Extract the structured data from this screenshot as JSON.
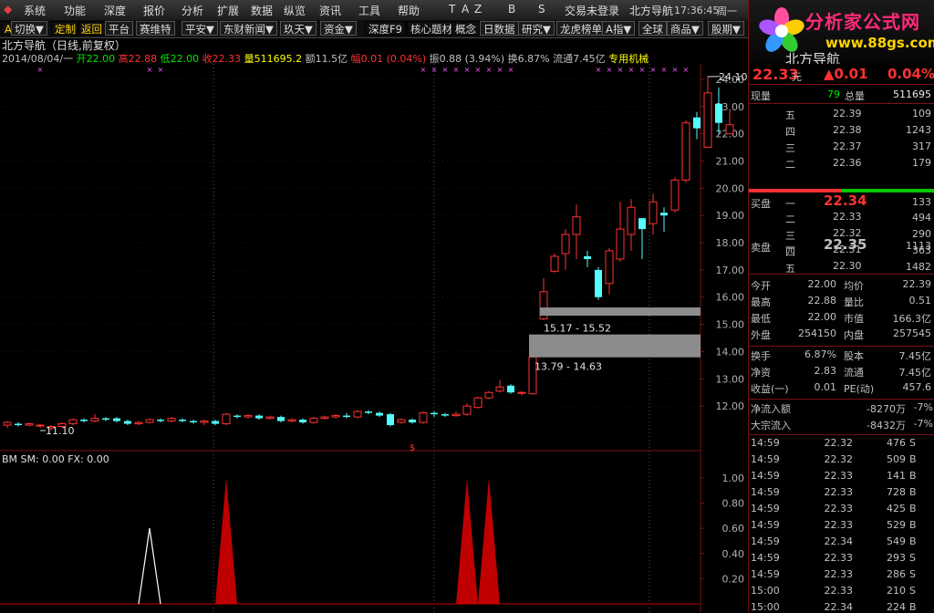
{
  "menu": {
    "items": [
      "系统",
      "功能",
      "深度",
      "报价",
      "分析",
      "扩展",
      "数据",
      "纵览",
      "资讯",
      "工具",
      "帮助"
    ],
    "shortcuts": [
      "T",
      "A",
      "Z",
      "B",
      "S"
    ],
    "login": "交易未登录",
    "app_name": "北方导航",
    "time": "17:36:45",
    "weekday": "周一"
  },
  "toolbar": {
    "mark": "A",
    "switch": "切换▼",
    "custom": "定制",
    "back": "返回",
    "platform": "平台",
    "saiweite": "赛维特",
    "pingan": "平安▼",
    "dongcai": "东财新闻▼",
    "jiutian": "玖天▼",
    "zijin": "资金▼",
    "depth": "深度F9",
    "core": "核心题材",
    "concept": "概念",
    "daily": "日数据",
    "research": "研究▼",
    "dragon": "龙虎榜单",
    "aindex": "A指▼",
    "global": "全球",
    "goods": "商品▼",
    "futures": "股期▼"
  },
  "stock": {
    "title": "北方导航（日线,前复权）",
    "date": "2014/08/04/一",
    "open_label": "开",
    "open": "22.00",
    "high_label": "高",
    "high": "22.88",
    "low_label": "低",
    "low": "22.00",
    "close_label": "收",
    "close": "22.33",
    "vol_label": "量",
    "vol": "511695.2",
    "amt_label": "额",
    "amt": "11.5亿",
    "chg_label": "幅",
    "chg": "0.01 (0.04%)",
    "amp_label": "振",
    "amp": "0.88 (3.94%)",
    "turn_label": "换",
    "turn": "6.87%",
    "float_label": "流通",
    "float": "7.45亿",
    "sector": "专用机械"
  },
  "chart_data": [
    {
      "type": "candlestick",
      "y_ticks": [
        "24.00",
        "23.00",
        "22.00",
        "21.00",
        "20.00",
        "19.00",
        "18.00",
        "17.00",
        "16.00",
        "15.00",
        "14.00",
        "13.00",
        "12.00"
      ],
      "ylim": [
        11.0,
        24.5
      ],
      "annotations": {
        "max_label": "24.10",
        "min_label": "11.10",
        "zone1": "15.17 - 15.52",
        "zone2": "13.79 - 14.63",
        "event_mark": "$"
      },
      "candles": [
        [
          11.3,
          11.4,
          11.2,
          11.45
        ],
        [
          11.35,
          11.3,
          11.25,
          11.4
        ],
        [
          11.3,
          11.35,
          11.25,
          11.4
        ],
        [
          11.3,
          11.3,
          11.2,
          11.35
        ],
        [
          11.2,
          11.25,
          11.1,
          11.3
        ],
        [
          11.25,
          11.35,
          11.2,
          11.4
        ],
        [
          11.35,
          11.5,
          11.3,
          11.55
        ],
        [
          11.5,
          11.45,
          11.4,
          11.55
        ],
        [
          11.45,
          11.55,
          11.4,
          11.7
        ],
        [
          11.55,
          11.5,
          11.45,
          11.6
        ],
        [
          11.55,
          11.45,
          11.4,
          11.6
        ],
        [
          11.45,
          11.35,
          11.3,
          11.5
        ],
        [
          11.35,
          11.4,
          11.3,
          11.45
        ],
        [
          11.4,
          11.5,
          11.35,
          11.55
        ],
        [
          11.5,
          11.45,
          11.4,
          11.55
        ],
        [
          11.45,
          11.55,
          11.4,
          11.6
        ],
        [
          11.5,
          11.45,
          11.4,
          11.55
        ],
        [
          11.45,
          11.4,
          11.35,
          11.5
        ],
        [
          11.4,
          11.45,
          11.3,
          11.5
        ],
        [
          11.45,
          11.35,
          11.3,
          11.5
        ],
        [
          11.35,
          11.7,
          11.3,
          11.75
        ],
        [
          11.65,
          11.6,
          11.55,
          11.7
        ],
        [
          11.6,
          11.65,
          11.55,
          11.7
        ],
        [
          11.65,
          11.55,
          11.5,
          11.7
        ],
        [
          11.55,
          11.6,
          11.5,
          11.65
        ],
        [
          11.6,
          11.45,
          11.4,
          11.65
        ],
        [
          11.45,
          11.5,
          11.4,
          11.55
        ],
        [
          11.5,
          11.4,
          11.35,
          11.55
        ],
        [
          11.4,
          11.55,
          11.35,
          11.6
        ],
        [
          11.55,
          11.6,
          11.5,
          11.65
        ],
        [
          11.6,
          11.65,
          11.55,
          11.7
        ],
        [
          11.65,
          11.6,
          11.55,
          11.75
        ],
        [
          11.6,
          11.8,
          11.55,
          11.85
        ],
        [
          11.8,
          11.75,
          11.7,
          11.85
        ],
        [
          11.75,
          11.65,
          11.6,
          11.8
        ],
        [
          11.7,
          11.3,
          11.25,
          11.75
        ],
        [
          11.4,
          11.5,
          11.35,
          11.55
        ],
        [
          11.5,
          11.4,
          11.35,
          11.55
        ],
        [
          11.4,
          11.75,
          11.35,
          11.8
        ],
        [
          11.75,
          11.7,
          11.6,
          11.8
        ],
        [
          11.7,
          11.65,
          11.6,
          11.75
        ],
        [
          11.65,
          11.7,
          11.6,
          11.8
        ],
        [
          11.7,
          12.0,
          11.65,
          12.1
        ],
        [
          11.95,
          12.3,
          11.9,
          12.35
        ],
        [
          12.3,
          12.5,
          12.25,
          12.55
        ],
        [
          12.55,
          12.7,
          12.5,
          12.95
        ],
        [
          12.75,
          12.5,
          12.45,
          12.8
        ],
        [
          12.5,
          12.5,
          12.4,
          12.55
        ],
        [
          12.45,
          13.8,
          12.45,
          13.8
        ],
        [
          15.2,
          16.2,
          15.15,
          16.7
        ],
        [
          16.95,
          17.5,
          16.9,
          17.6
        ],
        [
          17.6,
          18.3,
          17.0,
          18.5
        ],
        [
          18.3,
          18.95,
          17.4,
          19.4
        ],
        [
          17.5,
          17.4,
          17.1,
          17.7
        ],
        [
          17.0,
          16.0,
          15.9,
          17.1
        ],
        [
          16.5,
          17.7,
          16.1,
          17.8
        ],
        [
          17.4,
          18.5,
          17.3,
          19.5
        ],
        [
          18.3,
          19.3,
          17.7,
          19.6
        ],
        [
          18.9,
          18.5,
          17.4,
          18.9
        ],
        [
          18.7,
          19.5,
          18.3,
          19.8
        ],
        [
          19.1,
          19.0,
          18.4,
          19.3
        ],
        [
          19.2,
          20.3,
          19.1,
          20.4
        ],
        [
          20.3,
          22.4,
          20.2,
          22.5
        ],
        [
          22.6,
          22.2,
          21.8,
          22.8
        ],
        [
          21.5,
          23.5,
          21.5,
          24.1
        ],
        [
          23.1,
          22.4,
          22.0,
          23.7
        ],
        [
          22.0,
          22.33,
          22.0,
          22.88
        ]
      ]
    },
    {
      "type": "area",
      "title": "BM SM: 0.00  FX: 0.00",
      "y_ticks": [
        "1.00",
        "0.80",
        "0.60",
        "0.40",
        "0.20"
      ],
      "ylim": [
        0,
        1.05
      ],
      "red_spikes": [
        {
          "index": 20,
          "value": 1.0
        },
        {
          "index": 42,
          "value": 1.0
        },
        {
          "index": 44,
          "value": 1.0
        }
      ],
      "white_spikes": [
        {
          "index": 13,
          "value": 0.6
        }
      ]
    }
  ],
  "quote": {
    "logo_text": "分析家公式网",
    "logo_url": "www.88gs.com",
    "name": "北方导航",
    "price": "22.33",
    "price_unit": "元",
    "change": "▲0.01",
    "pct": "0.04%",
    "now_vol_label": "现量",
    "now_vol": "79",
    "total_vol_label": "总量",
    "total_vol": "511695",
    "sell_title": "卖盘",
    "buy_title": "买盘",
    "asks": [
      {
        "label": "五",
        "price": "22.39",
        "vol": "109"
      },
      {
        "label": "四",
        "price": "22.38",
        "vol": "1243"
      },
      {
        "label": "三",
        "price": "22.37",
        "vol": "317"
      },
      {
        "label": "二",
        "price": "22.36",
        "vol": "179"
      },
      {
        "label": "一",
        "price": "22.35",
        "vol": "1113"
      }
    ],
    "bids": [
      {
        "label": "一",
        "price": "22.34",
        "vol": "133"
      },
      {
        "label": "二",
        "price": "22.33",
        "vol": "494"
      },
      {
        "label": "三",
        "price": "22.32",
        "vol": "290"
      },
      {
        "label": "四",
        "price": "22.31",
        "vol": "363"
      },
      {
        "label": "五",
        "price": "22.30",
        "vol": "1482"
      }
    ],
    "stats": [
      {
        "l1": "今开",
        "v1": "22.00",
        "l2": "均价",
        "v2": "22.39"
      },
      {
        "l1": "最高",
        "v1": "22.88",
        "l2": "量比",
        "v2": "0.51"
      },
      {
        "l1": "最低",
        "v1": "22.00",
        "l2": "市值",
        "v2": "166.3亿"
      },
      {
        "l1": "外盘",
        "v1": "254150",
        "l2": "内盘",
        "v2": "257545"
      }
    ],
    "fund": [
      {
        "l1": "换手",
        "v1": "6.87%",
        "l2": "股本",
        "v2": "7.45亿"
      },
      {
        "l1": "净资",
        "v1": "2.83",
        "l2": "流通",
        "v2": "7.45亿"
      },
      {
        "l1": "收益(一)",
        "v1": "0.01",
        "l2": "PE(动)",
        "v2": "457.6"
      }
    ],
    "flow": [
      {
        "label": "净流入额",
        "value": "-8270万",
        "pct": "-7%"
      },
      {
        "label": "大宗流入",
        "value": "-8432万",
        "pct": "-7%"
      }
    ],
    "ticks": [
      {
        "time": "14:59",
        "price": "22.32",
        "vol": "476",
        "side": "S"
      },
      {
        "time": "14:59",
        "price": "22.32",
        "vol": "509",
        "side": "B"
      },
      {
        "time": "14:59",
        "price": "22.33",
        "vol": "141",
        "side": "B"
      },
      {
        "time": "14:59",
        "price": "22.33",
        "vol": "728",
        "side": "B"
      },
      {
        "time": "14:59",
        "price": "22.33",
        "vol": "425",
        "side": "B"
      },
      {
        "time": "14:59",
        "price": "22.33",
        "vol": "529",
        "side": "B"
      },
      {
        "time": "14:59",
        "price": "22.34",
        "vol": "549",
        "side": "B"
      },
      {
        "time": "14:59",
        "price": "22.33",
        "vol": "293",
        "side": "S"
      },
      {
        "time": "14:59",
        "price": "22.33",
        "vol": "286",
        "side": "S"
      },
      {
        "time": "15:00",
        "price": "22.33",
        "vol": "210",
        "side": "S"
      },
      {
        "time": "15:00",
        "price": "22.34",
        "vol": "224",
        "side": "B"
      }
    ]
  },
  "colors": {
    "up": "#ff3232",
    "down": "#54fcfc",
    "grid": "#7a1010",
    "accent": "#ffd400"
  }
}
